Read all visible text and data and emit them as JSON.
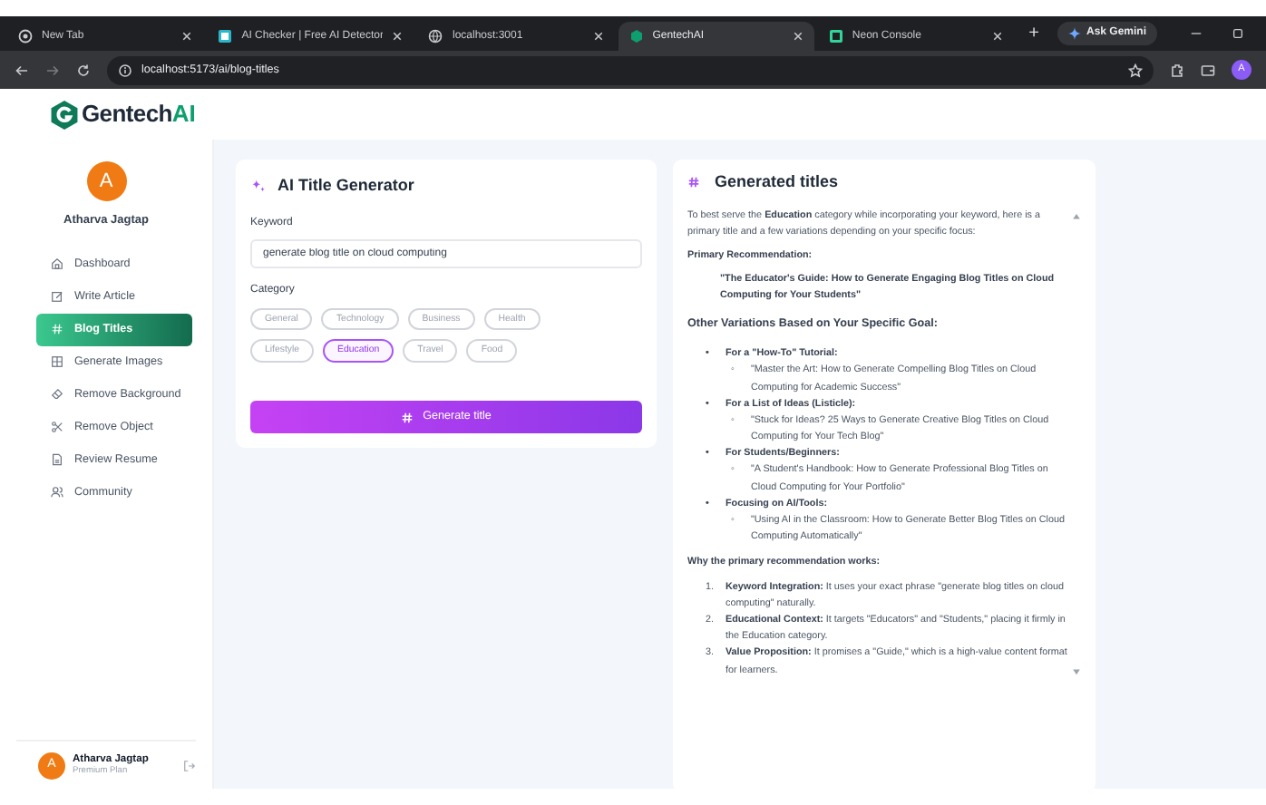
{
  "browser": {
    "tabs": [
      {
        "title": "New Tab",
        "selected": false
      },
      {
        "title": "AI Checker | Free AI Detector",
        "selected": false
      },
      {
        "title": "localhost:3001",
        "selected": false
      },
      {
        "title": "GentechAI",
        "selected": true
      },
      {
        "title": "Neon Console",
        "selected": false
      }
    ],
    "new_tab": "+",
    "ask_button": "Ask Gemini",
    "url": "localhost:5173/ai/blog-titles",
    "profile": "A"
  },
  "app": {
    "logo_text": "Gentech",
    "logo_accent": "AI"
  },
  "sidebar": {
    "avatar": "A",
    "user_name": "Atharva Jagtap",
    "items": [
      {
        "label": "Dashboard",
        "selected": false
      },
      {
        "label": "Write Article",
        "selected": false
      },
      {
        "label": "Blog Titles",
        "selected": true
      },
      {
        "label": "Generate Images",
        "selected": false
      },
      {
        "label": "Remove Background",
        "selected": false
      },
      {
        "label": "Remove Object",
        "selected": false
      },
      {
        "label": "Review Resume",
        "selected": false
      },
      {
        "label": "Community",
        "selected": false
      }
    ],
    "footer": {
      "avatar": "A",
      "name": "Atharva Jagtap",
      "plan": "Premium Plan"
    }
  },
  "generator": {
    "title": "AI Title Generator",
    "keyword_label": "Keyword",
    "keyword_value": "generate blog title on cloud computing",
    "category_label": "Category",
    "categories": [
      {
        "label": "General",
        "selected": false
      },
      {
        "label": "Technology",
        "selected": false
      },
      {
        "label": "Business",
        "selected": false
      },
      {
        "label": "Health",
        "selected": false
      },
      {
        "label": "Lifestyle",
        "selected": false
      },
      {
        "label": "Education",
        "selected": true
      },
      {
        "label": "Travel",
        "selected": false
      },
      {
        "label": "Food",
        "selected": false
      }
    ],
    "button": "Generate title"
  },
  "results": {
    "title": "Generated titles",
    "intro": "To best serve the **Education** category while incorporating your keyword, here is a primary title and a few variations depending on your specific focus:",
    "primary_heading": "Primary Recommendation:",
    "primary_title": "\"The Educator's Guide: How to Generate Engaging Blog Titles on Cloud Computing for Your Students\"",
    "variations_heading": "Other Variations Based on Your Specific Goal:",
    "variations": [
      {
        "marker": "•",
        "label": "For a \"How-To\" Tutorial:",
        "sub_marker": "◦",
        "title": "\"Master the Art: How to Generate Compelling Blog Titles on Cloud Computing for Academic Success\""
      },
      {
        "marker": "•",
        "label": "For a List of Ideas (Listicle):",
        "sub_marker": "◦",
        "title": "\"Stuck for Ideas? 25 Ways to Generate Creative Blog Titles on Cloud Computing for Your Tech Blog\""
      },
      {
        "marker": "•",
        "label": "For Students/Beginners:",
        "sub_marker": "◦",
        "title": "\"A Student's Handbook: How to Generate Professional Blog Titles on Cloud Computing for Your Portfolio\""
      },
      {
        "marker": "•",
        "label": "Focusing on AI/Tools:",
        "sub_marker": "◦",
        "title": "\"Using AI in the Classroom: How to Generate Better Blog Titles on Cloud Computing Automatically\""
      }
    ],
    "why_heading": "Why the primary recommendation works:",
    "reasons": [
      {
        "marker": "1.",
        "text": "**Keyword Integration:** It uses your exact phrase \"generate blog titles on cloud computing\" naturally."
      },
      {
        "marker": "2.",
        "text": "**Educational Context:** It targets \"Educators\" and \"Students,\" placing it firmly in the Education category."
      },
      {
        "marker": "3.",
        "text": "**Value Proposition:** It promises a \"Guide,\" which is a high-value content format for learners."
      }
    ]
  }
}
